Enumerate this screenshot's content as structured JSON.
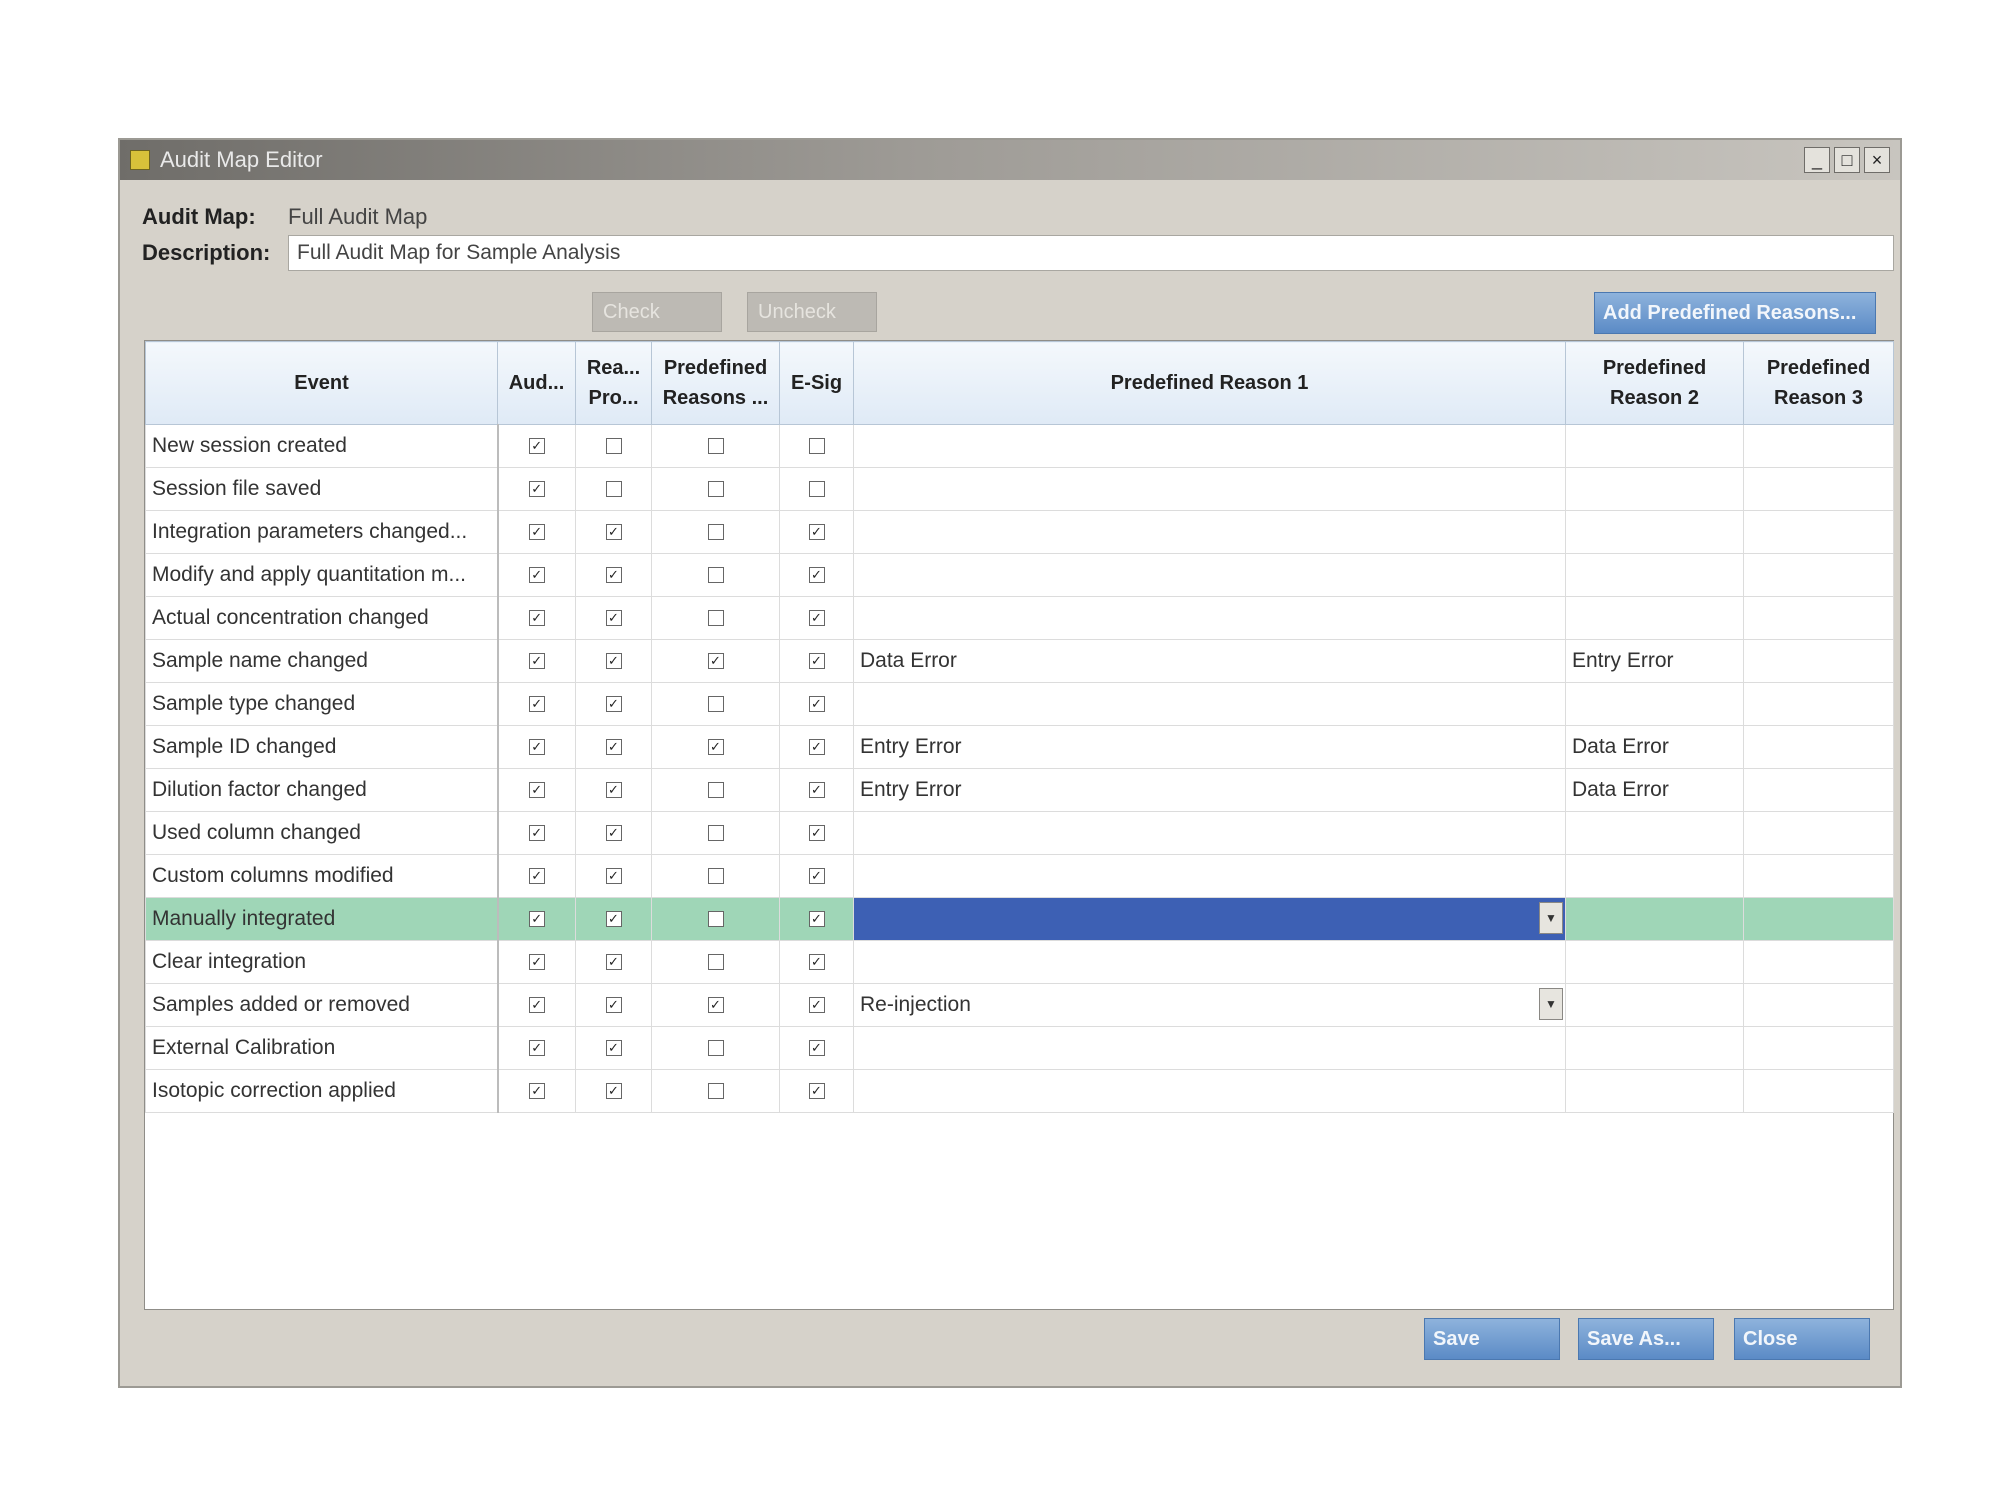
{
  "window": {
    "title": "Audit Map Editor",
    "minimize": "_",
    "maximize": "□",
    "close": "×"
  },
  "header": {
    "audit_map_label": "Audit Map:",
    "audit_map_value": "Full Audit Map",
    "description_label": "Description:",
    "description_value": "Full Audit Map for Sample Analysis"
  },
  "toolbar": {
    "check_label": "Check",
    "uncheck_label": "Uncheck",
    "add_reasons_label": "Add Predefined Reasons..."
  },
  "columns": [
    "Event",
    "Aud...",
    "Rea... Pro...",
    "Predefined Reasons ...",
    "E-Sig",
    "Predefined Reason 1",
    "Predefined Reason 2",
    "Predefined Reason 3"
  ],
  "rows": [
    {
      "event": "New session created",
      "audit": true,
      "reason_prompt": false,
      "predefined": false,
      "esig": false,
      "reason1": "",
      "reason2": "",
      "reason3": ""
    },
    {
      "event": "Session file saved",
      "audit": true,
      "reason_prompt": false,
      "predefined": false,
      "esig": false,
      "reason1": "",
      "reason2": "",
      "reason3": ""
    },
    {
      "event": "Integration parameters changed...",
      "audit": true,
      "reason_prompt": true,
      "predefined": false,
      "esig": true,
      "reason1": "",
      "reason2": "",
      "reason3": ""
    },
    {
      "event": "Modify and apply quantitation m...",
      "audit": true,
      "reason_prompt": true,
      "predefined": false,
      "esig": true,
      "reason1": "",
      "reason2": "",
      "reason3": ""
    },
    {
      "event": "Actual concentration changed",
      "audit": true,
      "reason_prompt": true,
      "predefined": false,
      "esig": true,
      "reason1": "",
      "reason2": "",
      "reason3": ""
    },
    {
      "event": "Sample name changed",
      "audit": true,
      "reason_prompt": true,
      "predefined": true,
      "esig": true,
      "reason1": "Data Error",
      "reason2": "Entry Error",
      "reason3": ""
    },
    {
      "event": "Sample type changed",
      "audit": true,
      "reason_prompt": true,
      "predefined": false,
      "esig": true,
      "reason1": "",
      "reason2": "",
      "reason3": ""
    },
    {
      "event": "Sample ID changed",
      "audit": true,
      "reason_prompt": true,
      "predefined": true,
      "esig": true,
      "reason1": "Entry Error",
      "reason2": "Data Error",
      "reason3": ""
    },
    {
      "event": "Dilution factor changed",
      "audit": true,
      "reason_prompt": true,
      "predefined": false,
      "esig": true,
      "reason1": "Entry Error",
      "reason2": "Data Error",
      "reason3": ""
    },
    {
      "event": "Used column changed",
      "audit": true,
      "reason_prompt": true,
      "predefined": false,
      "esig": true,
      "reason1": "",
      "reason2": "",
      "reason3": ""
    },
    {
      "event": "Custom columns modified",
      "audit": true,
      "reason_prompt": true,
      "predefined": false,
      "esig": true,
      "reason1": "",
      "reason2": "",
      "reason3": ""
    },
    {
      "event": "Manually integrated",
      "audit": true,
      "reason_prompt": true,
      "predefined": false,
      "esig": true,
      "reason1": "",
      "reason2": "",
      "reason3": "",
      "selected": true,
      "dropdown": true
    },
    {
      "event": "Clear integration",
      "audit": true,
      "reason_prompt": true,
      "predefined": false,
      "esig": true,
      "reason1": "",
      "reason2": "",
      "reason3": ""
    },
    {
      "event": "Samples added or removed",
      "audit": true,
      "reason_prompt": true,
      "predefined": true,
      "esig": true,
      "reason1": "Re-injection",
      "reason2": "",
      "reason3": "",
      "dropdown": true
    },
    {
      "event": "External Calibration",
      "audit": true,
      "reason_prompt": true,
      "predefined": false,
      "esig": true,
      "reason1": "",
      "reason2": "",
      "reason3": ""
    },
    {
      "event": "Isotopic correction applied",
      "audit": true,
      "reason_prompt": true,
      "predefined": false,
      "esig": true,
      "reason1": "",
      "reason2": "",
      "reason3": ""
    }
  ],
  "footer": {
    "save_label": "Save",
    "save_as_label": "Save As...",
    "close_label": "Close"
  }
}
